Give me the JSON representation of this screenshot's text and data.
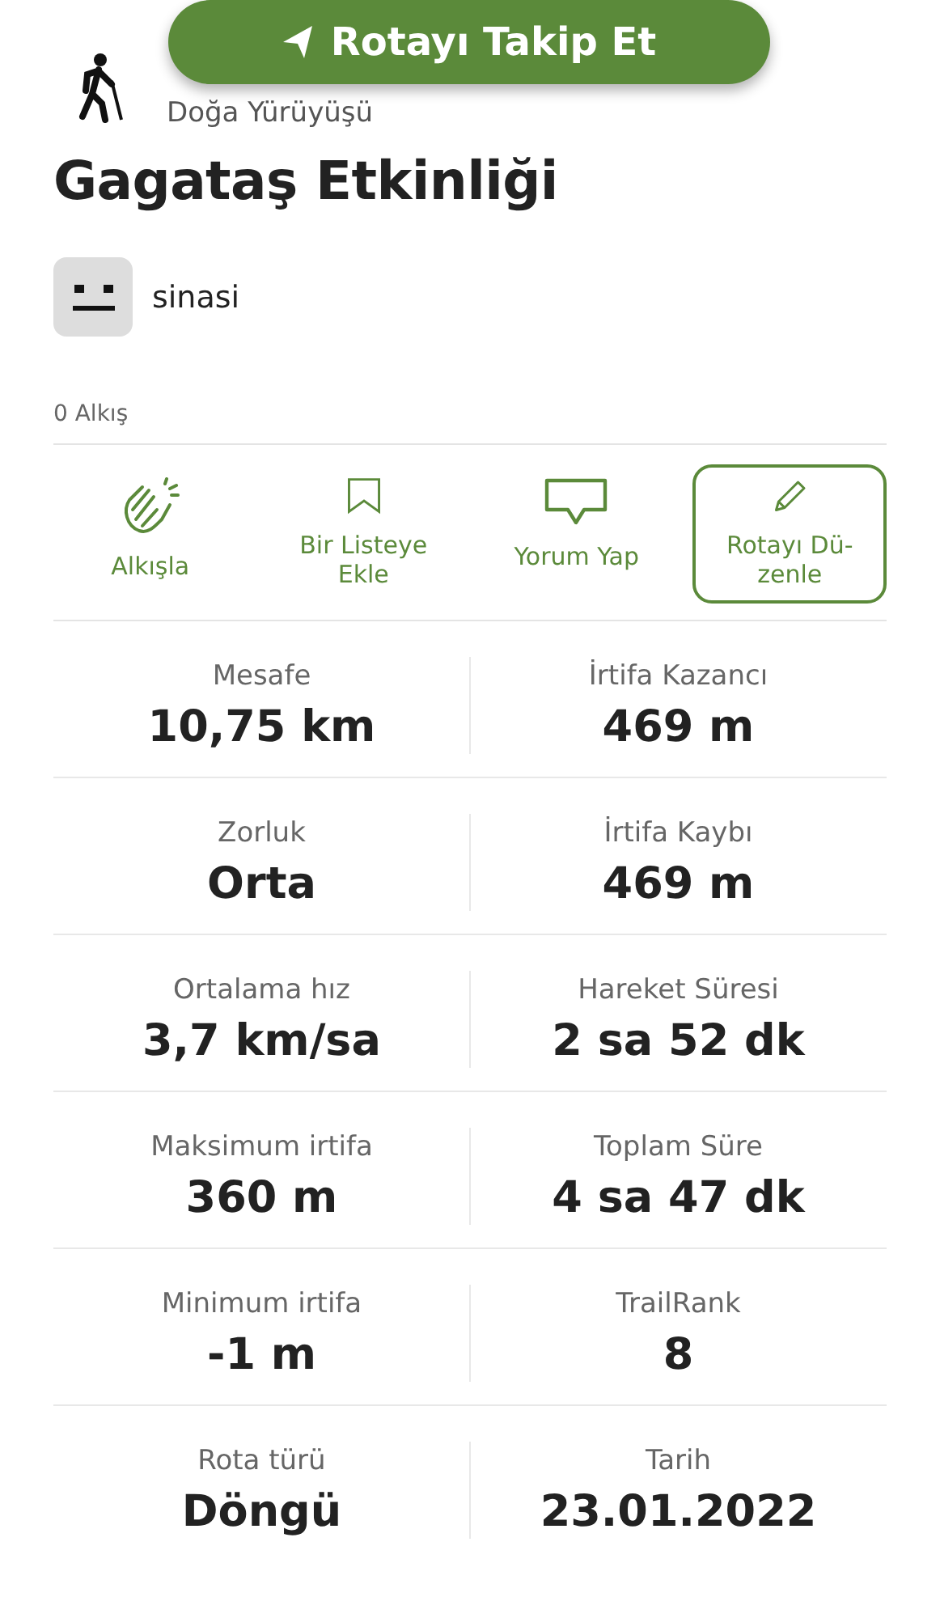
{
  "follow_button": {
    "label": "Rotayı Takip Et"
  },
  "activity_type": "Doğa Yürüyüşü",
  "title": "Gagataş Etkinliği",
  "user": {
    "name": "sinasi"
  },
  "claps": "0 Alkış",
  "actions": [
    {
      "kind": "clap",
      "label": "Alkışla",
      "outlined": false
    },
    {
      "kind": "bookmark",
      "label": "Bir Listeye Ekle",
      "outlined": false
    },
    {
      "kind": "comment",
      "label": "Yorum Yap",
      "outlined": false
    },
    {
      "kind": "edit",
      "label": "Rotayı Dü-zenle",
      "outlined": true
    }
  ],
  "stats": [
    {
      "label": "Mesafe",
      "value": "10,75 km"
    },
    {
      "label": "İrtifa Kazancı",
      "value": "469 m"
    },
    {
      "label": "Zorluk",
      "value": "Orta"
    },
    {
      "label": "İrtifa Kaybı",
      "value": "469 m"
    },
    {
      "label": "Ortalama hız",
      "value": "3,7 km/sa"
    },
    {
      "label": "Hareket Süresi",
      "value": "2 sa 52 dk"
    },
    {
      "label": "Maksimum irtifa",
      "value": "360 m"
    },
    {
      "label": "Toplam Süre",
      "value": "4 sa 47 dk"
    },
    {
      "label": "Minimum irtifa",
      "value": "-1 m"
    },
    {
      "label": "TrailRank",
      "value": "8"
    },
    {
      "label": "Rota türü",
      "value": "Döngü"
    },
    {
      "label": "Tarih",
      "value": "23.01.2022"
    }
  ]
}
